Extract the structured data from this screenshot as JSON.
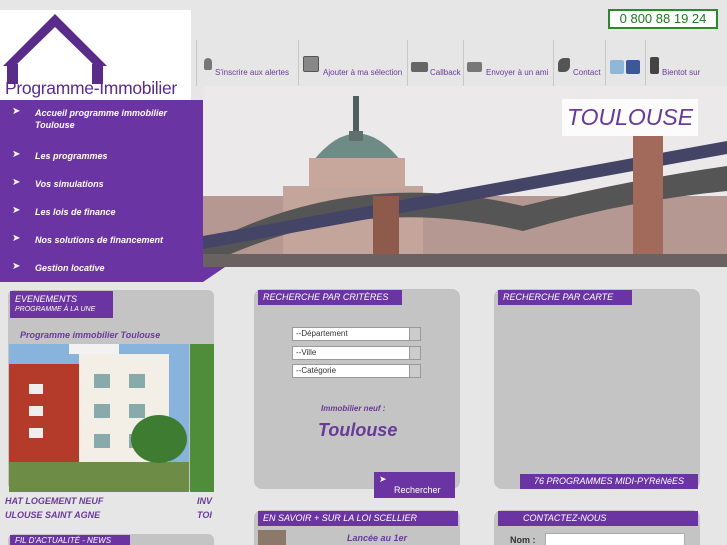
{
  "logo": {
    "text": "Programme-Immobilier"
  },
  "phone": "0 800 88 19 24",
  "toolbar": {
    "items": [
      {
        "label": "S'inscrire aux alertes",
        "icon": "bulb-icon"
      },
      {
        "label": "Ajouter à ma sélection",
        "icon": "download-icon"
      },
      {
        "label": "Callback",
        "icon": "keyboard-icon"
      },
      {
        "label": "Envoyer à un ami",
        "icon": "mail-icon"
      },
      {
        "label": "Contact",
        "icon": "phone-icon"
      },
      {
        "label": "",
        "icon": "social-icons"
      },
      {
        "label": "Bientot sur",
        "icon": "mobile-icon"
      }
    ]
  },
  "nav": {
    "arrow": "➤",
    "items": [
      "Accueil programme immobilier Toulouse",
      "Les programmes",
      "Vos simulations",
      "Les lois de finance",
      "Nos solutions de financement",
      "Gestion locative"
    ]
  },
  "hero": {
    "city": "TOULOUSE"
  },
  "events": {
    "title": "EVENEMENTS",
    "subtitle": "PROGRAMME À LA UNE",
    "program_title": "Programme immobilier Toulouse",
    "caption_line1": "HAT LOGEMENT NEUF",
    "caption_line2": "ULOUSE SAINT AGNE",
    "caption2_line1": "INV",
    "caption2_line2": "TOI"
  },
  "news": {
    "title": "FIL D'ACTUALITÉ - NEWS"
  },
  "criteria": {
    "title": "RECHERCHE PAR CRITÈRES",
    "selects": [
      "--Département",
      "--Ville",
      "--Catégorie"
    ],
    "immo_label": "Immobilier neuf :",
    "immo_city": "Toulouse",
    "search_label": "Rechercher"
  },
  "map": {
    "title": "RECHERCHE PAR CARTE",
    "count": "76 PROGRAMMES MIDI-PYRéNéES"
  },
  "scellier": {
    "title": "EN SAVOIR + SUR LA LOI SCELLIER",
    "text": "Lancée au 1er"
  },
  "contact": {
    "title": "CONTACTEZ-NOUS",
    "name_label": "Nom :"
  },
  "colors": {
    "brand": "#6a35a3",
    "panel": "#c4c4c4",
    "phone": "#1a7a1a"
  }
}
